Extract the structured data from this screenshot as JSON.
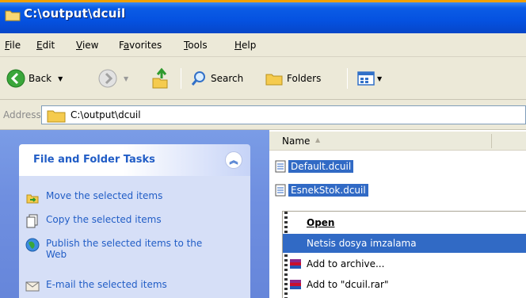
{
  "window": {
    "title": "C:\\output\\dcuil"
  },
  "menu": [
    {
      "pre": "",
      "u": "F",
      "post": "ile"
    },
    {
      "pre": "",
      "u": "E",
      "post": "dit"
    },
    {
      "pre": "",
      "u": "V",
      "post": "iew"
    },
    {
      "pre": "F",
      "u": "a",
      "post": "vorites"
    },
    {
      "pre": "",
      "u": "T",
      "post": "ools"
    },
    {
      "pre": "",
      "u": "H",
      "post": "elp"
    }
  ],
  "toolbar": {
    "back": "Back",
    "search": "Search",
    "folders": "Folders"
  },
  "address": {
    "label": "Address",
    "path": "C:\\output\\dcuil"
  },
  "tasks": {
    "heading": "File and Folder Tasks",
    "items": [
      "Move the selected items",
      "Copy the selected items",
      "Publish the selected items to the Web",
      "E-mail the selected items"
    ]
  },
  "files": {
    "column_name": "Name",
    "items": [
      "Default.dcuil",
      "EsnekStok.dcuil"
    ]
  },
  "context_menu": {
    "items": [
      {
        "label": "Open",
        "bold": true,
        "highlighted": false
      },
      {
        "label": "Netsis dosya imzalama",
        "bold": false,
        "highlighted": true
      },
      {
        "label": "Add to archive...",
        "bold": false,
        "highlighted": false
      },
      {
        "label": "Add to \"dcuil.rar\"",
        "bold": false,
        "highlighted": false
      }
    ]
  },
  "colors": {
    "title_blue": "#0551e0",
    "task_link": "#215dc6",
    "selection": "#316ac5"
  }
}
